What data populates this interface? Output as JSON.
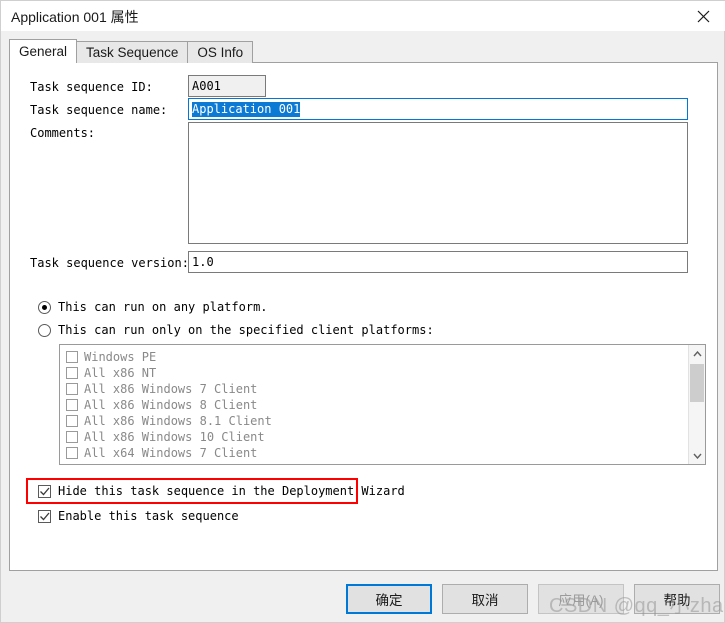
{
  "window": {
    "title": "Application 001 属性",
    "close_label": "×"
  },
  "tabs": [
    {
      "label": "General",
      "active": true
    },
    {
      "label": "Task Sequence",
      "active": false
    },
    {
      "label": "OS Info",
      "active": false
    }
  ],
  "general": {
    "id_label": "Task sequence ID:",
    "id_value": "A001",
    "name_label": "Task sequence name:",
    "name_value": "Application 001",
    "comments_label": "Comments:",
    "comments_value": "",
    "comments_placeholder": "",
    "version_label": "Task sequence version:",
    "version_value": "1.0",
    "platform_any_label": "This can run on any platform.",
    "platform_specific_label": "This can run only on the specified client platforms:",
    "platform_selected": "any",
    "platforms": [
      {
        "label": "Windows PE",
        "checked": false
      },
      {
        "label": "All x86 NT",
        "checked": false
      },
      {
        "label": "All x86 Windows 7 Client",
        "checked": false
      },
      {
        "label": "All x86 Windows 8 Client",
        "checked": false
      },
      {
        "label": "All x86 Windows 8.1 Client",
        "checked": false
      },
      {
        "label": "All x86 Windows 10 Client",
        "checked": false
      },
      {
        "label": "All x64 Windows 7 Client",
        "checked": false
      }
    ],
    "hide_label": "Hide this task sequence in the Deployment Wizard",
    "hide_checked": true,
    "enable_label": "Enable this task sequence",
    "enable_checked": true
  },
  "footer": {
    "ok_label": "确定",
    "cancel_label": "取消",
    "apply_label": "应用(A)",
    "help_label": "帮助"
  },
  "watermark": {
    "text": "CSDN @qq_小zhang"
  },
  "colors": {
    "accent": "#0078d7",
    "selection": "#0c7ad4",
    "annotation": "#ff0000",
    "dialog_bg": "#f0f0f0",
    "panel_bg": "#ffffff",
    "disabled_text": "#898989"
  }
}
